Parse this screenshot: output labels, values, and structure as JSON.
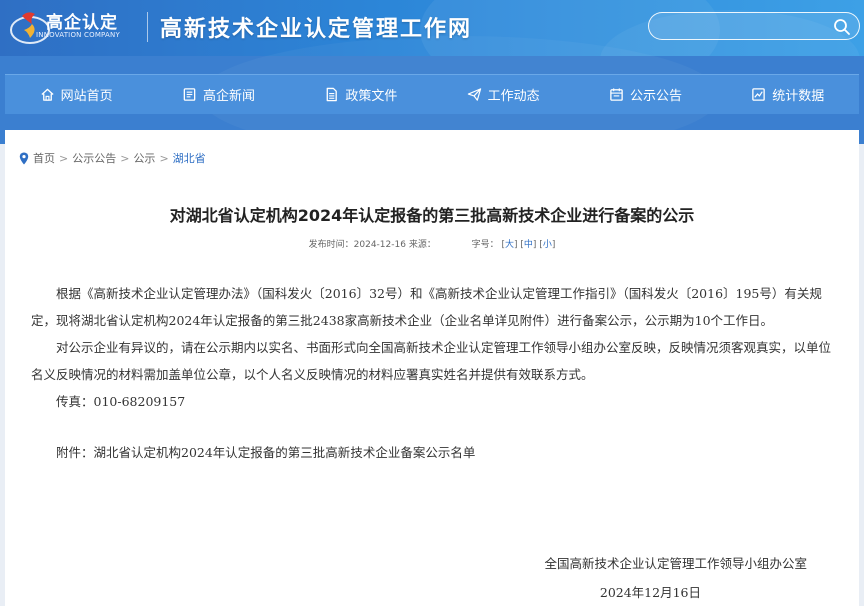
{
  "header": {
    "logo_cn": "高企认定",
    "logo_en": "INNOVATION COMPANY",
    "site_title": "高新技术企业认定管理工作网",
    "search_placeholder": ""
  },
  "nav": [
    {
      "label": "网站首页",
      "icon": "home-icon"
    },
    {
      "label": "高企新闻",
      "icon": "news-icon"
    },
    {
      "label": "政策文件",
      "icon": "document-icon"
    },
    {
      "label": "工作动态",
      "icon": "send-icon"
    },
    {
      "label": "公示公告",
      "icon": "notice-icon"
    },
    {
      "label": "统计数据",
      "icon": "chart-icon"
    }
  ],
  "breadcrumb": {
    "items": [
      "首页",
      "公示公告",
      "公示"
    ],
    "current": "湖北省",
    "separator": ">"
  },
  "article": {
    "title": "对湖北省认定机构2024年认定报备的第三批高新技术企业进行备案的公示",
    "publish_label": "发布时间：",
    "publish_date": "2024-12-16",
    "source_label": "来源：",
    "fontsize_label": "字号：",
    "size_large": "大",
    "size_medium": "中",
    "size_small": "小",
    "paragraphs": [
      "根据《高新技术企业认定管理办法》（国科发火〔2016〕32号）和《高新技术企业认定管理工作指引》（国科发火〔2016〕195号）有关规定，现将湖北省认定机构2024年认定报备的第三批2438家高新技术企业（企业名单详见附件）进行备案公示，公示期为10个工作日。",
      "对公示企业有异议的，请在公示期内以实名、书面形式向全国高新技术企业认定管理工作领导小组办公室反映，反映情况须客观真实，以单位名义反映情况的材料需加盖单位公章，以个人名义反映情况的材料应署真实姓名并提供有效联系方式。",
      "传真：010-68209157"
    ],
    "attachment": "附件：湖北省认定机构2024年认定报备的第三批高新技术企业备案公示名单",
    "signature": "全国高新技术企业认定管理工作领导小组办公室",
    "sign_date": "2024年12月16日"
  },
  "colors": {
    "header_blue": "#2f6fc4",
    "nav_blue": "#4a90dc",
    "link_blue": "#2f6fc4",
    "logo_red": "#e03a2e"
  }
}
